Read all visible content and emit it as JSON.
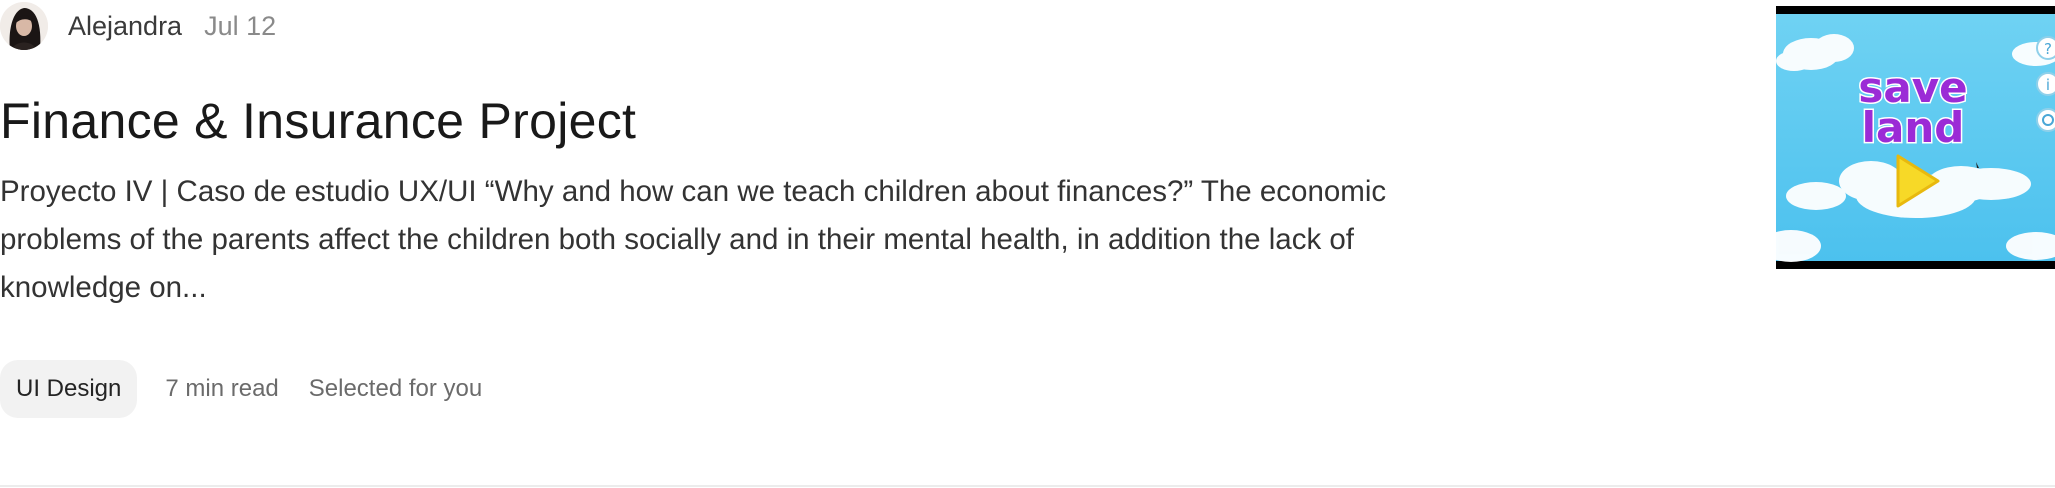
{
  "author": {
    "name": "Alejandra",
    "date": "Jul 12"
  },
  "post": {
    "title": "Finance & Insurance Project",
    "excerpt": "Proyecto IV | Caso de estudio UX/UI “Why and how can we teach children about finances?” The economic problems of the parents affect the children both socially and in their mental health, in addition the lack of knowledge on...",
    "tag": "UI Design",
    "read_time": "7 min read",
    "selection_note": "Selected for you"
  },
  "thumbnail": {
    "game_logo_line1": "save",
    "game_logo_line2": "land",
    "side_icons": [
      "help-icon",
      "info-icon",
      "settings-icon"
    ],
    "play_icon": "play-icon",
    "colors": {
      "sky": "#5ccaf0",
      "logo": "#9b2bd6",
      "play": "#f7d927"
    }
  }
}
